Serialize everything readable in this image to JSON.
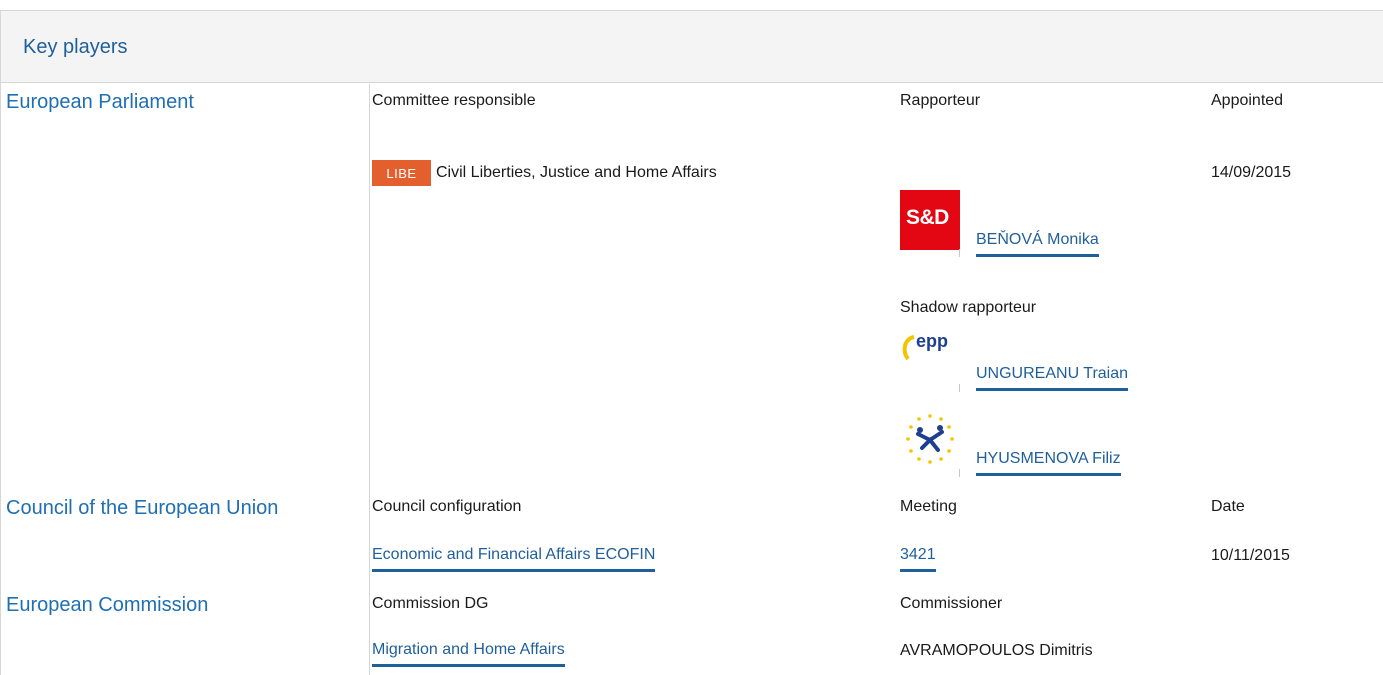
{
  "header": {
    "title": "Key players"
  },
  "european_parliament": {
    "section_title": "European Parliament",
    "labels": {
      "committee_responsible": "Committee responsible",
      "rapporteur": "Rapporteur",
      "appointed": "Appointed",
      "shadow_rapporteur": "Shadow rapporteur"
    },
    "committee": {
      "badge": "LIBE",
      "name": "Civil Liberties, Justice and Home Affairs",
      "appointed_date": "14/09/2015"
    },
    "rapporteur": {
      "party_logo": "S&D",
      "name": "BEŇOVÁ Monika"
    },
    "shadow_rapporteurs": [
      {
        "party_logo": "epp",
        "name": "UNGUREANU Traian"
      },
      {
        "party_logo": "alde-stars-icon",
        "name": "HYUSMENOVA Filiz"
      }
    ]
  },
  "council": {
    "section_title": "Council of the European Union",
    "labels": {
      "configuration": "Council configuration",
      "meeting": "Meeting",
      "date": "Date"
    },
    "configuration": "Economic and Financial Affairs ECOFIN",
    "meeting": "3421",
    "date": "10/11/2015"
  },
  "commission": {
    "section_title": "European Commission",
    "labels": {
      "dg": "Commission DG",
      "commissioner": "Commissioner"
    },
    "dg": "Migration and Home Affairs",
    "commissioner": "AVRAMOPOULOS Dimitris"
  },
  "colors": {
    "accent_blue": "#1f5f9a",
    "libe_orange": "#e35f2e",
    "sd_red": "#e30613",
    "epp_blue": "#1e3f8f",
    "epp_yellow": "#f5c400"
  }
}
